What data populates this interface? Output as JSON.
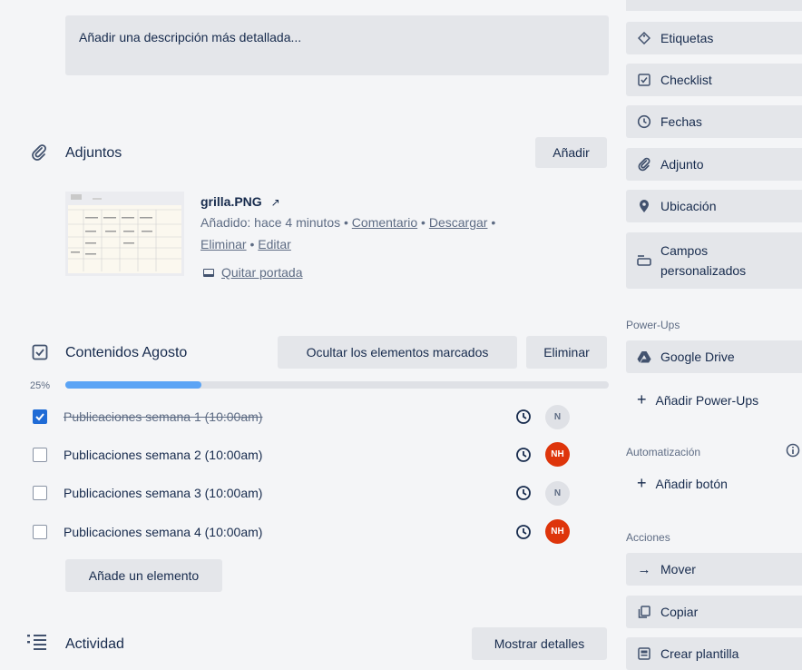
{
  "description": {
    "placeholder": "Añadir una descripción más detallada..."
  },
  "attachments": {
    "title": "Adjuntos",
    "add_button": "Añadir",
    "file": {
      "name": "grilla.PNG",
      "arrow": "↗",
      "added": "Añadido: hace 4 minutos • ",
      "comment": "Comentario",
      "sep1": " • ",
      "download": "Descargar",
      "sep2": " •",
      "delete": "Eliminar",
      "sep3": " • ",
      "edit": "Editar",
      "remove_cover": "Quitar portada"
    }
  },
  "checklist": {
    "title": "Contenidos Agosto",
    "hide_checked": "Ocultar los elementos marcados",
    "delete": "Eliminar",
    "progress_label": "25%",
    "progress": 0.25,
    "items": [
      {
        "text": "Publicaciones semana 1 (10:00am)",
        "checked": true,
        "assignee": "N"
      },
      {
        "text": "Publicaciones semana 2 (10:00am)",
        "checked": false,
        "assignee": "NH"
      },
      {
        "text": "Publicaciones semana 3 (10:00am)",
        "checked": false,
        "assignee": "N"
      },
      {
        "text": "Publicaciones semana 4 (10:00am)",
        "checked": false,
        "assignee": "NH"
      }
    ],
    "add_item": "Añade un elemento"
  },
  "activity": {
    "title": "Actividad",
    "show_details": "Mostrar detalles"
  },
  "sidebar": {
    "items": [
      {
        "label": "Etiquetas",
        "icon": "tag-icon"
      },
      {
        "label": "Checklist",
        "icon": "checklist-icon"
      },
      {
        "label": "Fechas",
        "icon": "clock-icon"
      },
      {
        "label": "Adjunto",
        "icon": "paperclip-icon"
      },
      {
        "label": "Ubicación",
        "icon": "location-pin-icon"
      },
      {
        "label": "Campos\npersonalizados",
        "icon": "custom-fields-icon"
      }
    ],
    "powerups_label": "Power-Ups",
    "google_drive": "Google Drive",
    "add_powerups": "Añadir Power-Ups",
    "automation_label": "Automatización",
    "add_button": "Añadir botón",
    "actions_label": "Acciones",
    "actions": [
      {
        "label": "Mover",
        "icon": "arrow-right-icon"
      },
      {
        "label": "Copiar",
        "icon": "copy-icon"
      },
      {
        "label": "Crear plantilla",
        "icon": "template-icon"
      }
    ]
  },
  "colors": {
    "accent": "#1f6bd6",
    "progress": "#5ba4f5",
    "avatar_nh": "#de350b",
    "button_bg": "#e4e6ea"
  }
}
